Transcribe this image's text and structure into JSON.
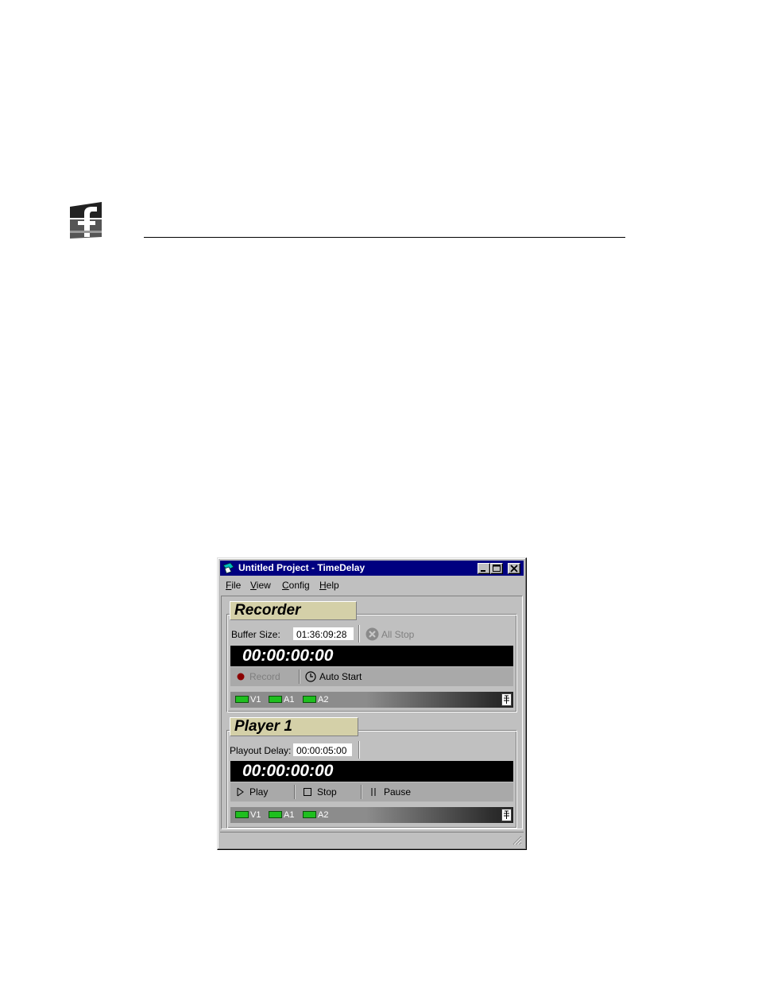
{
  "window": {
    "title": "Untitled Project - TimeDelay",
    "menu": [
      {
        "accel": "F",
        "rest": "ile"
      },
      {
        "accel": "V",
        "rest": "iew"
      },
      {
        "accel": "C",
        "rest": "onfig"
      },
      {
        "accel": "H",
        "rest": "elp"
      }
    ]
  },
  "recorder": {
    "tab": "Recorder",
    "buffer_label": "Buffer Size:",
    "buffer_value": "01:36:09:28",
    "all_stop": "All Stop",
    "timecode": "00:00:00:00",
    "record": "Record",
    "auto_start": "Auto Start",
    "channels": [
      "V1",
      "A1",
      "A2"
    ]
  },
  "player": {
    "tab": "Player 1",
    "delay_label": "Playout Delay:",
    "delay_value": "00:00:05:00",
    "timecode": "00:00:00:00",
    "play": "Play",
    "stop": "Stop",
    "pause": "Pause",
    "channels": [
      "V1",
      "A1",
      "A2"
    ]
  },
  "colors": {
    "titlebar": "#000080",
    "tab": "#d4d0a8",
    "led": "#1fbf1f",
    "record_dot": "#8b0000"
  }
}
